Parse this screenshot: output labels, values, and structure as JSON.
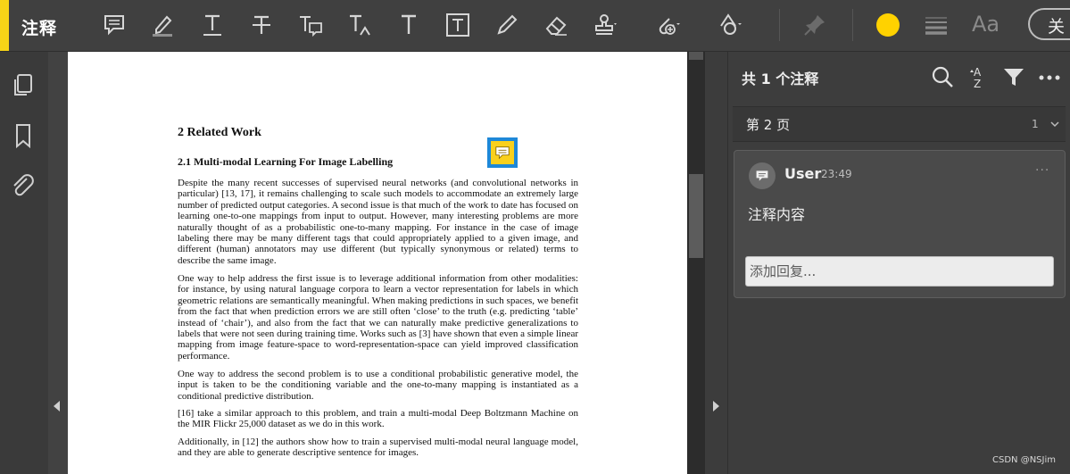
{
  "toolbar": {
    "title": "注释",
    "accent_color": "#f7d417",
    "current_color": "#ffd200",
    "font_label": "Aa",
    "close_label": "关",
    "tools": [
      "sticky-note",
      "highlight",
      "underline",
      "strikethrough",
      "replace-text",
      "insert-text",
      "add-text",
      "text-box",
      "draw",
      "eraser",
      "stamp",
      "attach-file",
      "shapes",
      "pin",
      "color",
      "line-thickness",
      "font"
    ]
  },
  "left_rail": {
    "icons": [
      "copy-pages-icon",
      "bookmark-icon",
      "attachment-icon"
    ]
  },
  "document": {
    "section_heading": "2   Related Work",
    "subsection_heading": "2.1   Multi-modal Learning For Image Labelling",
    "paragraphs": [
      "Despite the many recent successes of supervised neural networks (and convolutional networks in particular) [13, 17], it remains challenging to scale such models to accommodate an extremely large number of predicted output categories. A second issue is that much of the work to date has focused on learning one-to-one mappings from input to output. However, many interesting problems are more naturally thought of as a probabilistic one-to-many mapping. For instance in the case of image labeling there may be many different tags that could appropriately applied to a given image, and different (human) annotators may use different (but typically synonymous or related) terms to describe the same image.",
      "One way to help address the first issue is to leverage additional information from other modalities: for instance, by using natural language corpora to learn a vector representation for labels in which geometric relations are semantically meaningful. When making predictions in such spaces, we benefit from the fact that when prediction errors we are still often ‘close’ to the truth (e.g. predicting ‘table’ instead of ‘chair’), and also from the fact that we can naturally make predictive generalizations to labels that were not seen during training time. Works such as [3] have shown that even a simple linear mapping from image feature-space to word-representation-space can yield improved classification performance.",
      "One way to address the second problem is to use a conditional probabilistic generative model, the input is taken to be the conditioning variable and the one-to-many mapping is instantiated as a conditional predictive distribution.",
      "[16] take a similar approach to this problem, and train a multi-modal Deep Boltzmann Machine on the MIR Flickr 25,000 dataset as we do in this work.",
      "Additionally, in [12] the authors show how to train a supervised multi-modal neural language model, and they are able to generate descriptive sentence for images."
    ]
  },
  "comments_panel": {
    "count_label": "共 1 个注释",
    "page_label": "第 2 页",
    "page_comment_count": "1",
    "comment": {
      "user": "User",
      "time": "23:49",
      "more": "···",
      "content": "注释内容"
    },
    "reply_placeholder": "添加回复..."
  },
  "watermark": "CSDN @NSJim"
}
